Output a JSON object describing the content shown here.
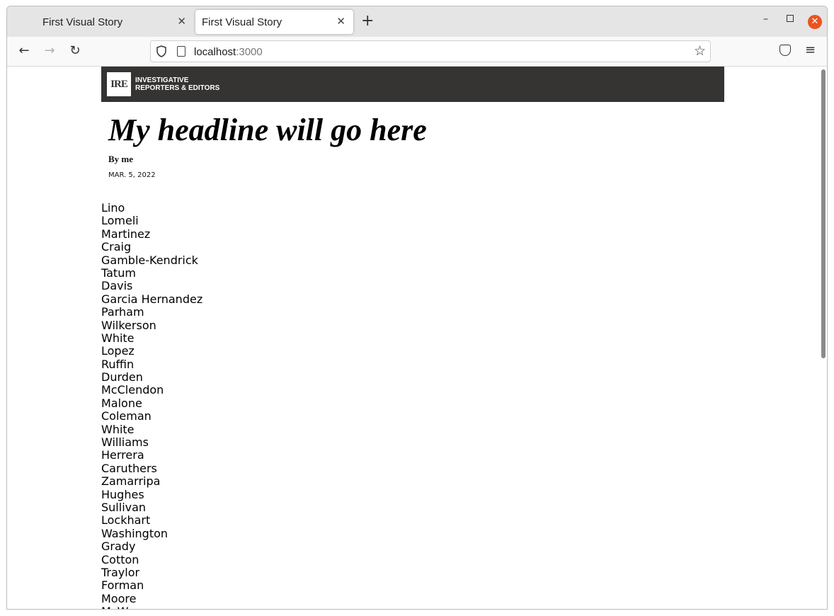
{
  "tabs": [
    {
      "title": "First Visual Story",
      "active": false
    },
    {
      "title": "First Visual Story",
      "active": true
    }
  ],
  "address": {
    "host": "localhost",
    "port": ":3000"
  },
  "icons": {
    "back": "back-arrow-icon",
    "forward": "forward-arrow-icon",
    "reload": "reload-icon",
    "shield": "shield-icon",
    "page": "page-icon",
    "star": "bookmark-star-icon",
    "pocket": "pocket-icon",
    "menu": "hamburger-menu-icon"
  },
  "colors": {
    "banner": "#353433",
    "close_button": "#e95420"
  },
  "page": {
    "logo": {
      "mark": "IRE",
      "line1": "INVESTIGATIVE",
      "line2": "REPORTERS & EDITORS"
    },
    "headline": "My headline will go here",
    "byline": "By me",
    "date": "MAR. 5, 2022",
    "names": [
      "Lino",
      "Lomeli",
      "Martinez",
      "Craig",
      "Gamble-Kendrick",
      "Tatum",
      "Davis",
      "Garcia Hernandez",
      "Parham",
      "Wilkerson",
      "White",
      "Lopez",
      "Ruffin",
      "Durden",
      "McClendon",
      "Malone",
      "Coleman",
      "White",
      "Williams",
      "Herrera",
      "Caruthers",
      "Zamarripa",
      "Hughes",
      "Sullivan",
      "Lockhart",
      "Washington",
      "Grady",
      "Cotton",
      "Traylor",
      "Forman",
      "Moore",
      "McW"
    ]
  }
}
